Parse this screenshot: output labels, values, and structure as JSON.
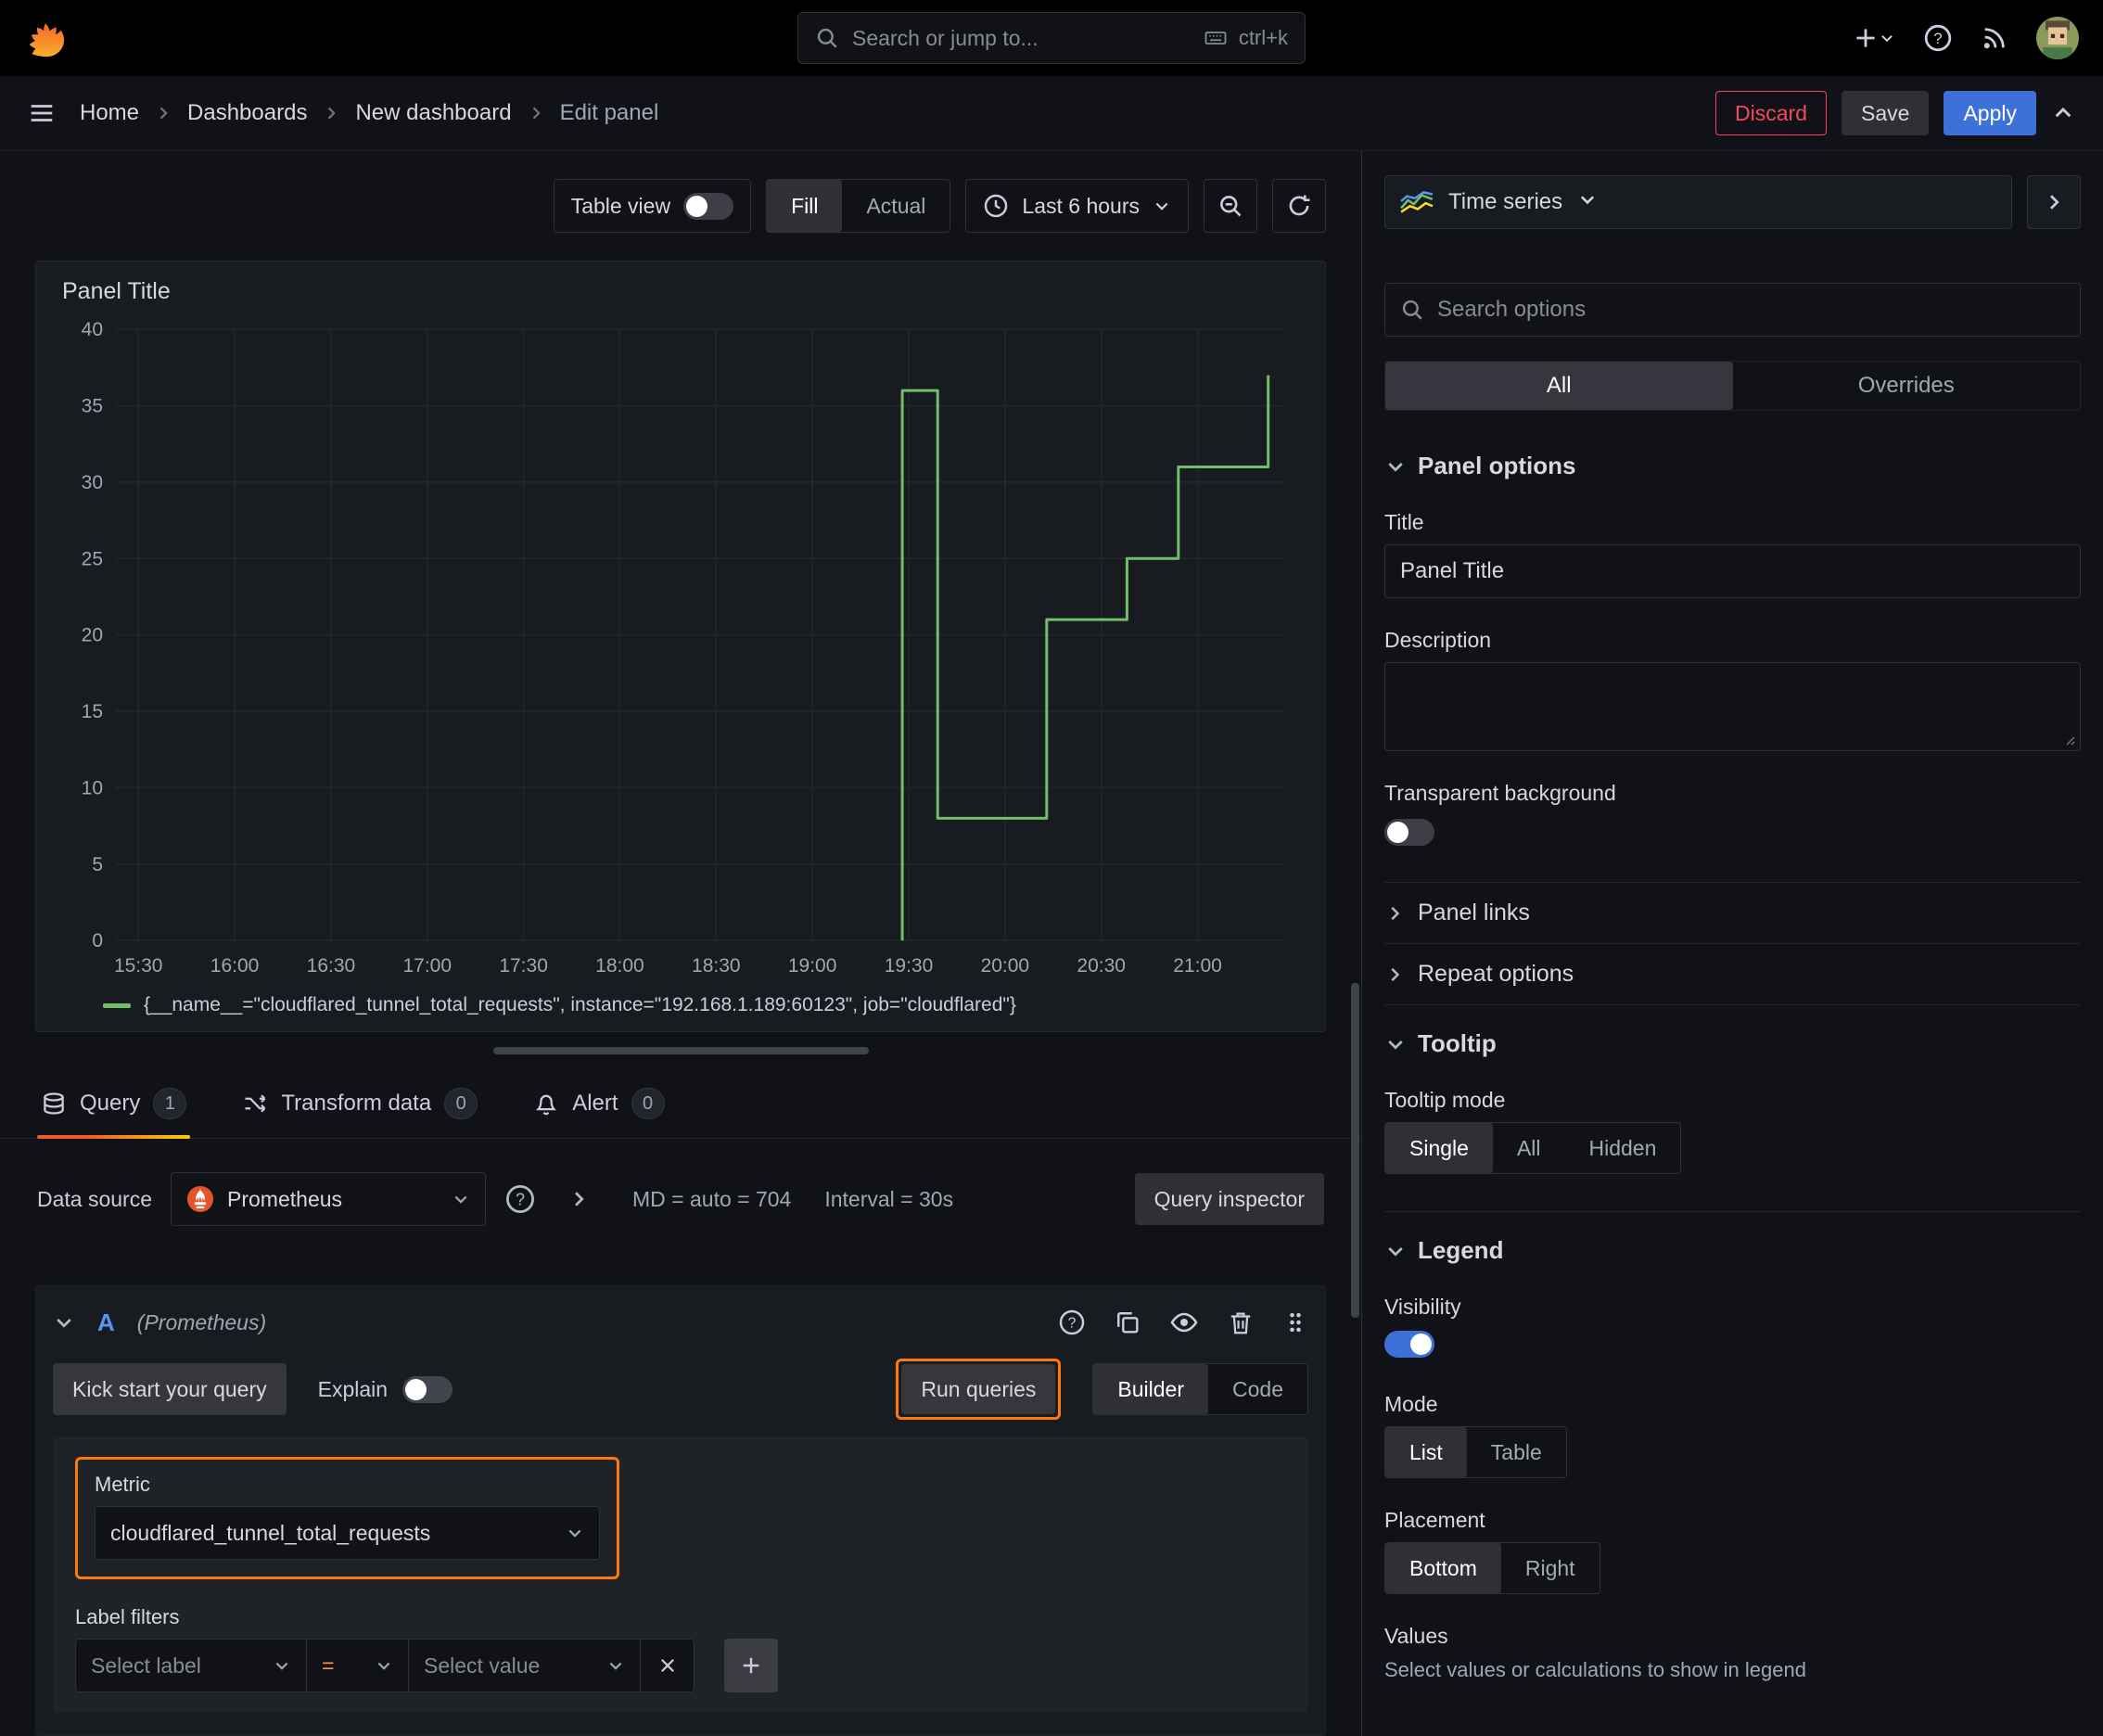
{
  "colors": {
    "accent_orange": "#ff780a",
    "primary_blue": "#3d71d9",
    "destructive_red": "#f2495c",
    "series_green": "#73bf69"
  },
  "topbar": {
    "search_placeholder": "Search or jump to...",
    "search_shortcut": "ctrl+k"
  },
  "nav": {
    "breadcrumbs": [
      "Home",
      "Dashboards",
      "New dashboard",
      "Edit panel"
    ],
    "discard_label": "Discard",
    "save_label": "Save",
    "apply_label": "Apply"
  },
  "panel_toolbar": {
    "table_view_label": "Table view",
    "fill_label": "Fill",
    "actual_label": "Actual",
    "time_range_label": "Last 6 hours"
  },
  "panel": {
    "title": "Panel Title"
  },
  "chart_data": {
    "type": "line",
    "title": "Panel Title",
    "xlabel": "",
    "ylabel": "",
    "x_tick_labels": [
      "15:30",
      "16:00",
      "16:30",
      "17:00",
      "17:30",
      "18:00",
      "18:30",
      "19:00",
      "19:30",
      "20:00",
      "20:30",
      "21:00"
    ],
    "x_tick_minutes": [
      0,
      30,
      60,
      90,
      120,
      150,
      180,
      210,
      240,
      270,
      300,
      330
    ],
    "x_range_minutes": [
      -7,
      357
    ],
    "y_ticks": [
      0,
      5,
      10,
      15,
      20,
      25,
      30,
      35,
      40
    ],
    "ylim": [
      0,
      40
    ],
    "grid": true,
    "legend_position": "bottom",
    "series": [
      {
        "name": "{__name__=\"cloudflared_tunnel_total_requests\", instance=\"192.168.1.189:60123\", job=\"cloudflared\"}",
        "color": "#73bf69",
        "points": [
          [
            238,
            0
          ],
          [
            238,
            36
          ],
          [
            249,
            36
          ],
          [
            249,
            8
          ],
          [
            283,
            8
          ],
          [
            283,
            21
          ],
          [
            308,
            21
          ],
          [
            308,
            25
          ],
          [
            324,
            25
          ],
          [
            324,
            31
          ],
          [
            352,
            31
          ],
          [
            352,
            37
          ]
        ]
      }
    ]
  },
  "query_tabs": {
    "query": {
      "label": "Query",
      "count": "1"
    },
    "transform": {
      "label": "Transform data",
      "count": "0"
    },
    "alert": {
      "label": "Alert",
      "count": "0"
    }
  },
  "query": {
    "datasource_label": "Data source",
    "datasource_value": "Prometheus",
    "stats_md": "MD = auto = 704",
    "stats_interval": "Interval = 30s",
    "inspector_label": "Query inspector",
    "ref_id": "A",
    "ref_note": "(Prometheus)",
    "kickstart_label": "Kick start your query",
    "explain_label": "Explain",
    "run_label": "Run queries",
    "builder_label": "Builder",
    "code_label": "Code",
    "metric_label": "Metric",
    "metric_value": "cloudflared_tunnel_total_requests",
    "label_filters_label": "Label filters",
    "select_label_placeholder": "Select label",
    "operator_value": "=",
    "select_value_placeholder": "Select value"
  },
  "sidebar": {
    "viz_type": "Time series",
    "search_placeholder": "Search options",
    "tabs": {
      "all": "All",
      "overrides": "Overrides"
    },
    "panel_options": {
      "heading": "Panel options",
      "title_label": "Title",
      "title_value": "Panel Title",
      "description_label": "Description",
      "transparent_label": "Transparent background",
      "panel_links_label": "Panel links",
      "repeat_options_label": "Repeat options"
    },
    "tooltip": {
      "heading": "Tooltip",
      "mode_label": "Tooltip mode",
      "single": "Single",
      "all": "All",
      "hidden": "Hidden",
      "selected": "Single"
    },
    "legend": {
      "heading": "Legend",
      "visibility_label": "Visibility",
      "mode_label": "Mode",
      "list": "List",
      "table": "Table",
      "mode_selected": "List",
      "placement_label": "Placement",
      "bottom": "Bottom",
      "right": "Right",
      "placement_selected": "Bottom",
      "values_label": "Values",
      "values_help": "Select values or calculations to show in legend"
    }
  }
}
